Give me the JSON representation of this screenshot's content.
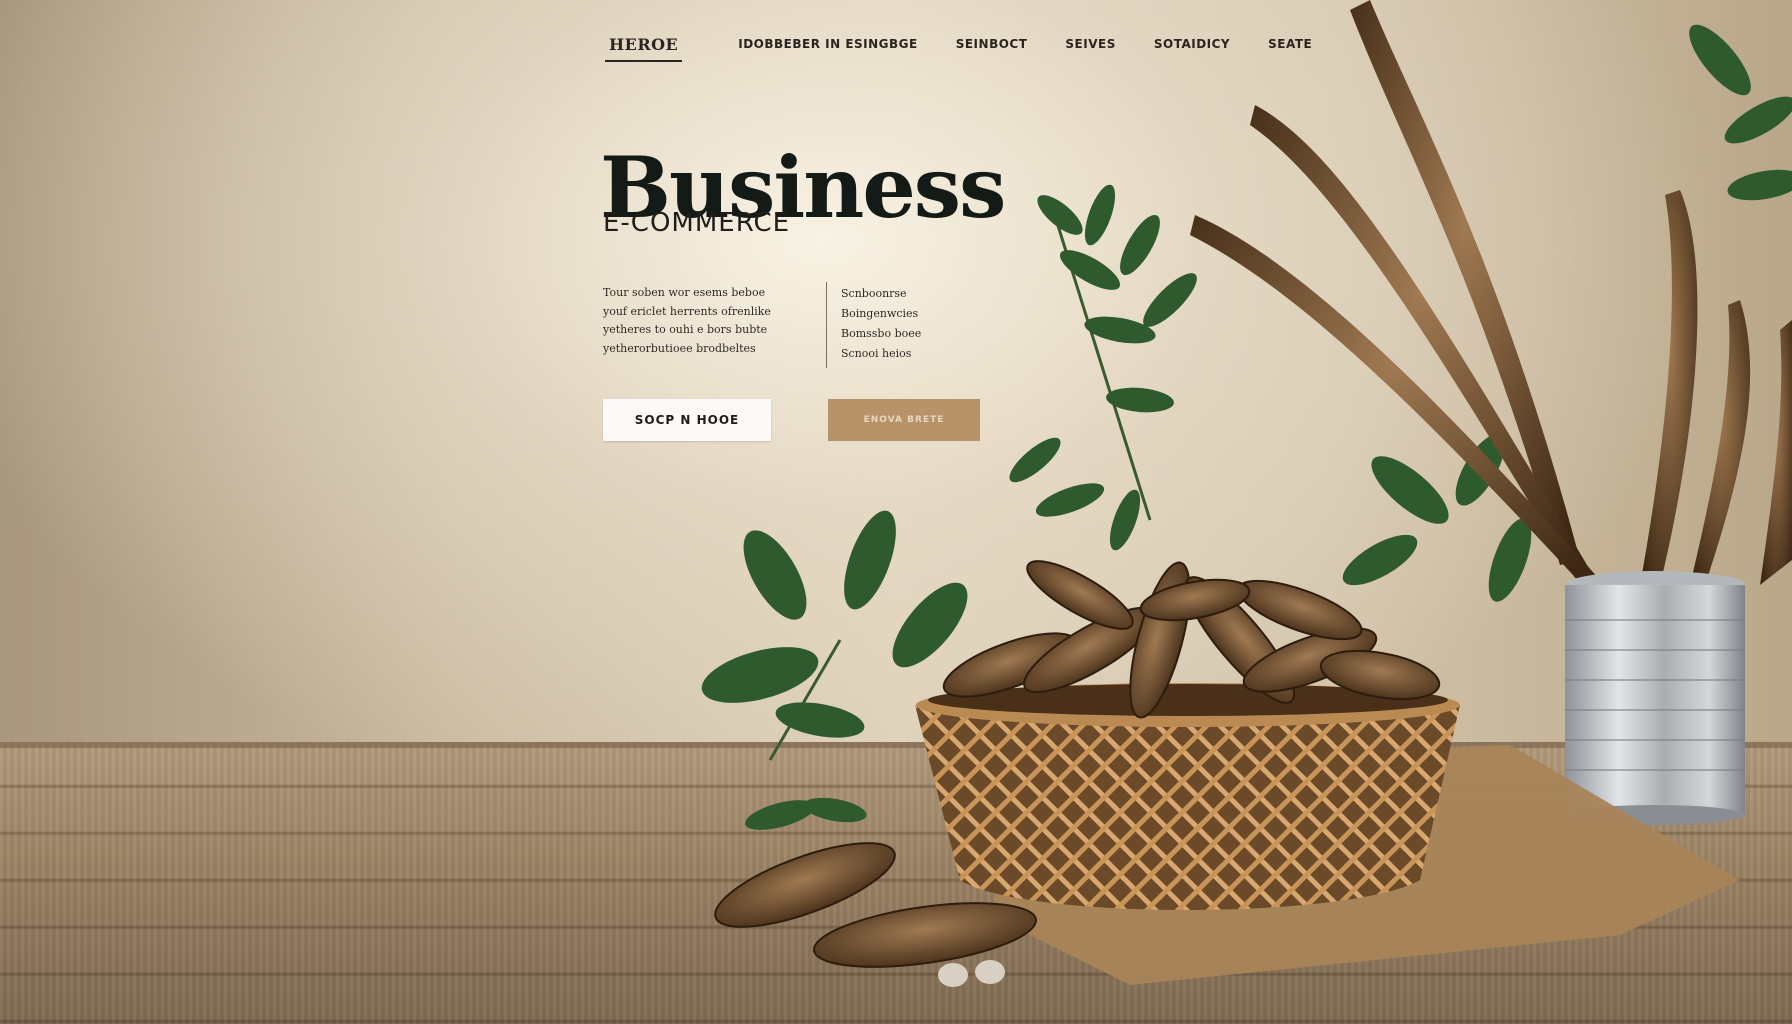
{
  "nav": {
    "items": [
      {
        "label": "HEROE",
        "active": true
      },
      {
        "label": "IDOBBEBER IN ESINGBGE",
        "active": false
      },
      {
        "label": "SEINBOCT",
        "active": false
      },
      {
        "label": "SEIVES",
        "active": false
      },
      {
        "label": "SOTAIDICY",
        "active": false
      },
      {
        "label": "SEATE",
        "active": false
      }
    ]
  },
  "hero": {
    "title": "Business",
    "subtitle": "E-COMMERCE",
    "left_text": [
      "Tour soben wor esems beboe",
      "youf ericlet herrents ofrenlike",
      "yetheres to ouhi e bors bubte",
      "yetherorbutioee brodbeltes"
    ],
    "right_text": [
      "Scnboonrse",
      "Boingenwcies",
      "Bomssbo boee",
      "Scnooi heios"
    ],
    "primary_button": "SOCP N HOOE",
    "secondary_button": "ENOVA BRETE"
  },
  "colors": {
    "title": "#141a16",
    "button_primary_bg": "#fcfaf6",
    "button_secondary_bg": "#b8936a",
    "leaf": "#2f5a2e",
    "pod": "#5a3c22"
  },
  "icons": {
    "basket": "basket-illustration",
    "tin_can": "tin-can-illustration",
    "pods": "seed-pod-illustration",
    "leaves": "leaf-illustration"
  }
}
